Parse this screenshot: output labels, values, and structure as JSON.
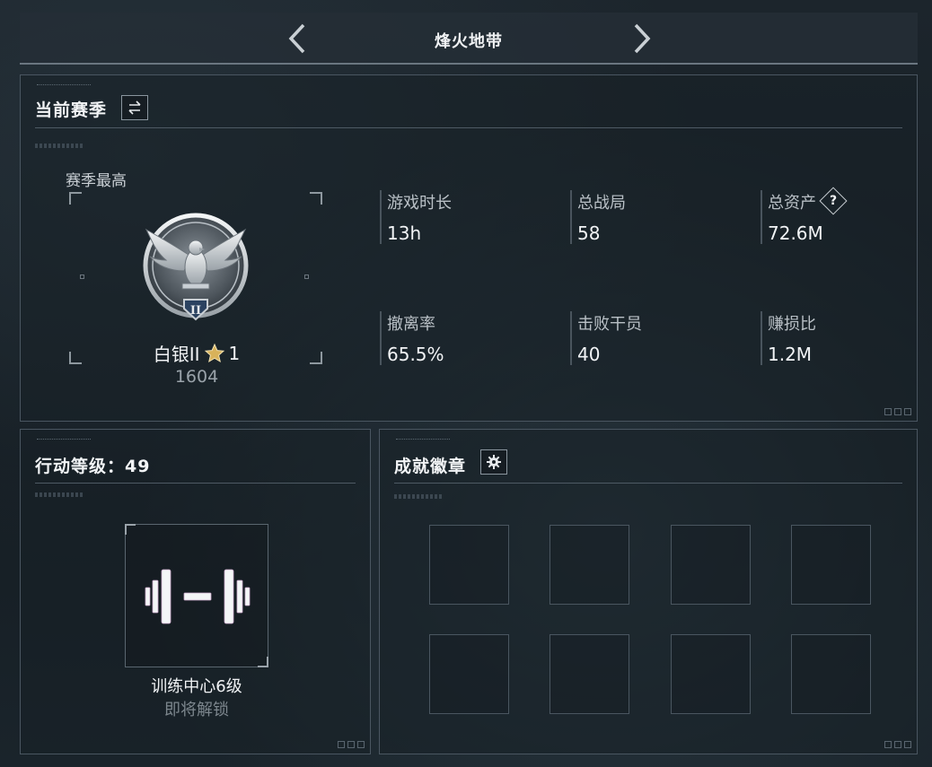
{
  "header": {
    "title": "烽火地带",
    "prev_icon": "chevron-left-icon",
    "next_icon": "chevron-right-icon"
  },
  "season": {
    "title": "当前赛季",
    "switch_icon": "swap-arrows-icon",
    "best_label": "赛季最高",
    "rank": {
      "name": "白银II",
      "stars": "1",
      "star_icon": "gold-star-icon",
      "score": "1604",
      "badge_icon": "silver-eagle-rank-badge-icon",
      "badge_tier": "II"
    },
    "stats": [
      {
        "label": "游戏时长",
        "value": "13h"
      },
      {
        "label": "总战局",
        "value": "58"
      },
      {
        "label": "总资产",
        "value": "72.6M",
        "help": "?"
      },
      {
        "label": "撤离率",
        "value": "65.5%"
      },
      {
        "label": "击败干员",
        "value": "40"
      },
      {
        "label": "赚损比",
        "value": "1.2M"
      }
    ]
  },
  "level": {
    "title": "行动等级：49",
    "facility_icon": "dumbbell-icon",
    "facility_name": "训练中心6级",
    "facility_status": "即将解锁"
  },
  "achievements": {
    "title": "成就徽章",
    "settings_icon": "gear-icon",
    "slots": 8
  },
  "colors": {
    "background": "#161e24",
    "panel_border": "#4a5661",
    "text_primary": "#f0f2f4",
    "text_muted": "#7c868d",
    "star_gold": "#d8b25a"
  }
}
